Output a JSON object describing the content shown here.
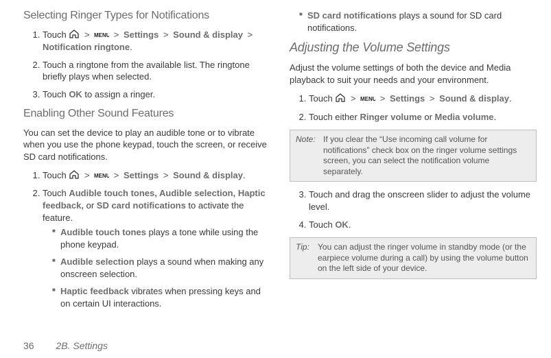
{
  "left": {
    "h1": "Selecting Ringer Types for Notifications",
    "steps1": {
      "s1a": "Touch ",
      "s1b": "Settings",
      "s1c": "Sound & display",
      "s1d": "Notification ringtone",
      "s2": "Touch a ringtone from the available list. The ringtone briefly plays when selected.",
      "s3a": "Touch ",
      "s3b": "OK",
      "s3c": " to assign a ringer."
    },
    "h2": "Enabling Other Sound Features",
    "p1": "You can set the device to play an audible tone or to vibrate when you use the phone keypad, touch the screen, or receive SD card notifications.",
    "steps2": {
      "s1a": "Touch ",
      "s1b": "Settings",
      "s1c": "Sound & display",
      "s2a": "Touch ",
      "s2b": "Audible touch tones, Audible selection, Haptic feedback,",
      "s2c": "  or ",
      "s2d": "SD card notifications",
      "s2e": " to activate the feature."
    },
    "bullets": {
      "b1a": "Audible touch tones",
      "b1b": " plays a tone while using the phone keypad.",
      "b2a": "Audible selection",
      "b2b": " plays a sound when making any onscreen selection.",
      "b3a": "Haptic feedback",
      "b3b": " vibrates when pressing keys and on certain UI interactions."
    }
  },
  "right": {
    "bullets_cont": {
      "b4a": "SD card notifications",
      "b4b": " plays a sound for SD card notifications."
    },
    "h1": "Adjusting the Volume Settings",
    "p1": "Adjust the volume settings of both the device and Media playback to suit your needs and your environment.",
    "steps": {
      "s1a": "Touch ",
      "s1b": "Settings",
      "s1c": "Sound & display",
      "s2a": "Touch either ",
      "s2b": "Ringer volume",
      "s2c": " or ",
      "s2d": "Media volume",
      "s2e": ".",
      "s3": "Touch and drag the onscreen slider to adjust the volume level.",
      "s4a": "Touch ",
      "s4b": "OK",
      "s4c": "."
    },
    "note_label": "Note:",
    "note_body": "If you clear the “Use incoming call volume for notifications” check box on the ringer volume settings screen, you can select the notification volume separately.",
    "tip_label": "Tip:",
    "tip_body": "You can adjust the ringer volume in standby mode (or the earpiece volume during a call) by using the volume button on the left side of your device."
  },
  "footer": {
    "page": "36",
    "section": "2B. Settings"
  },
  "sep": ">"
}
